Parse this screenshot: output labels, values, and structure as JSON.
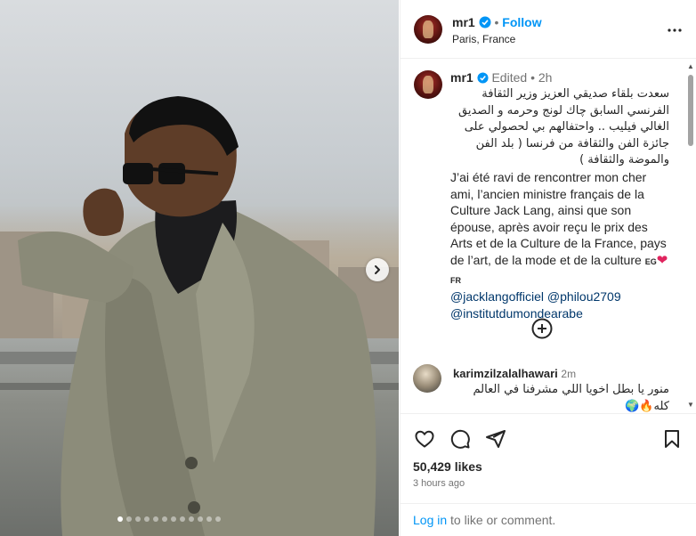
{
  "post": {
    "author": "mr1",
    "follow_label": "Follow",
    "dot_separator": "•",
    "location": "Paris, France"
  },
  "photo": {
    "slide_count": 12,
    "active_slide": 1
  },
  "caption": {
    "author": "mr1",
    "edited": "Edited",
    "age": "2h",
    "arabic_text": "سعدت بلقاء صديقي العزيز وزير الثقافة الفرنسي السابق چاك لونج وحرمه و الصديق الغالي فيليب .. واحتفالهم بي لحصولي على جائزة الفن والثقافة من فرنسا ( بلد الفن والموضة والثقافة )",
    "french_text": "J’ai été ravi de rencontrer mon cher ami, l’ancien ministre français de la Culture Jack Lang, ainsi que son épouse, après avoir reçu le prix des Arts et de la Culture de la France, pays de l’art, de la mode et de la culture",
    "flag_eg": "EG",
    "flag_fr": "FR",
    "mention_1": "@jacklangofficiel",
    "mention_2": "@philou2709",
    "mention_3": "@institutdumondearabe"
  },
  "comment": {
    "author": "karimzilzalalhawari",
    "age": "2m",
    "text_line1": "منور يا بطل اخويا اللي مشرفنا في العالم",
    "text_line2": "كله"
  },
  "engagement": {
    "likes": "50,429 likes",
    "time_ago": "3 hours ago",
    "login_link": "Log in",
    "login_suffix": " to like or comment."
  },
  "colors": {
    "accent": "#0095f6",
    "verified": "#0095f6",
    "heart": "#e0245e",
    "mention": "#00376b",
    "muted": "#737373"
  },
  "icons": [
    "verified-icon",
    "more-icon",
    "next-arrow-icon",
    "add-comments-icon",
    "heart-icon",
    "comment-icon",
    "share-icon",
    "save-icon"
  ]
}
